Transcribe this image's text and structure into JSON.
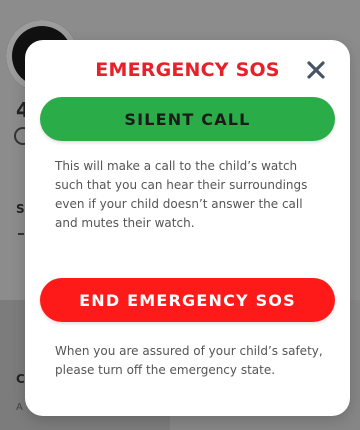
{
  "background": {
    "left_heading": "4",
    "left_letter_s": "S",
    "left_letter_c": "C",
    "left_letter_a": "A"
  },
  "dialog": {
    "title": "EMERGENCY SOS",
    "close_glyph": "close-icon",
    "silent_call_label": "SILENT CALL",
    "silent_call_description": "This will make a call to the child’s watch such that you can hear their surroundings even if your child doesn’t answer the call and mutes their watch.",
    "end_sos_label": "END EMERGENCY SOS",
    "end_sos_description": "When you are assured of your child’s safety, please turn off the emergency state."
  },
  "colors": {
    "title_red": "#e8202a",
    "green_button": "#2aac48",
    "red_button": "#ff1a1a",
    "close_icon": "#4a5468"
  }
}
